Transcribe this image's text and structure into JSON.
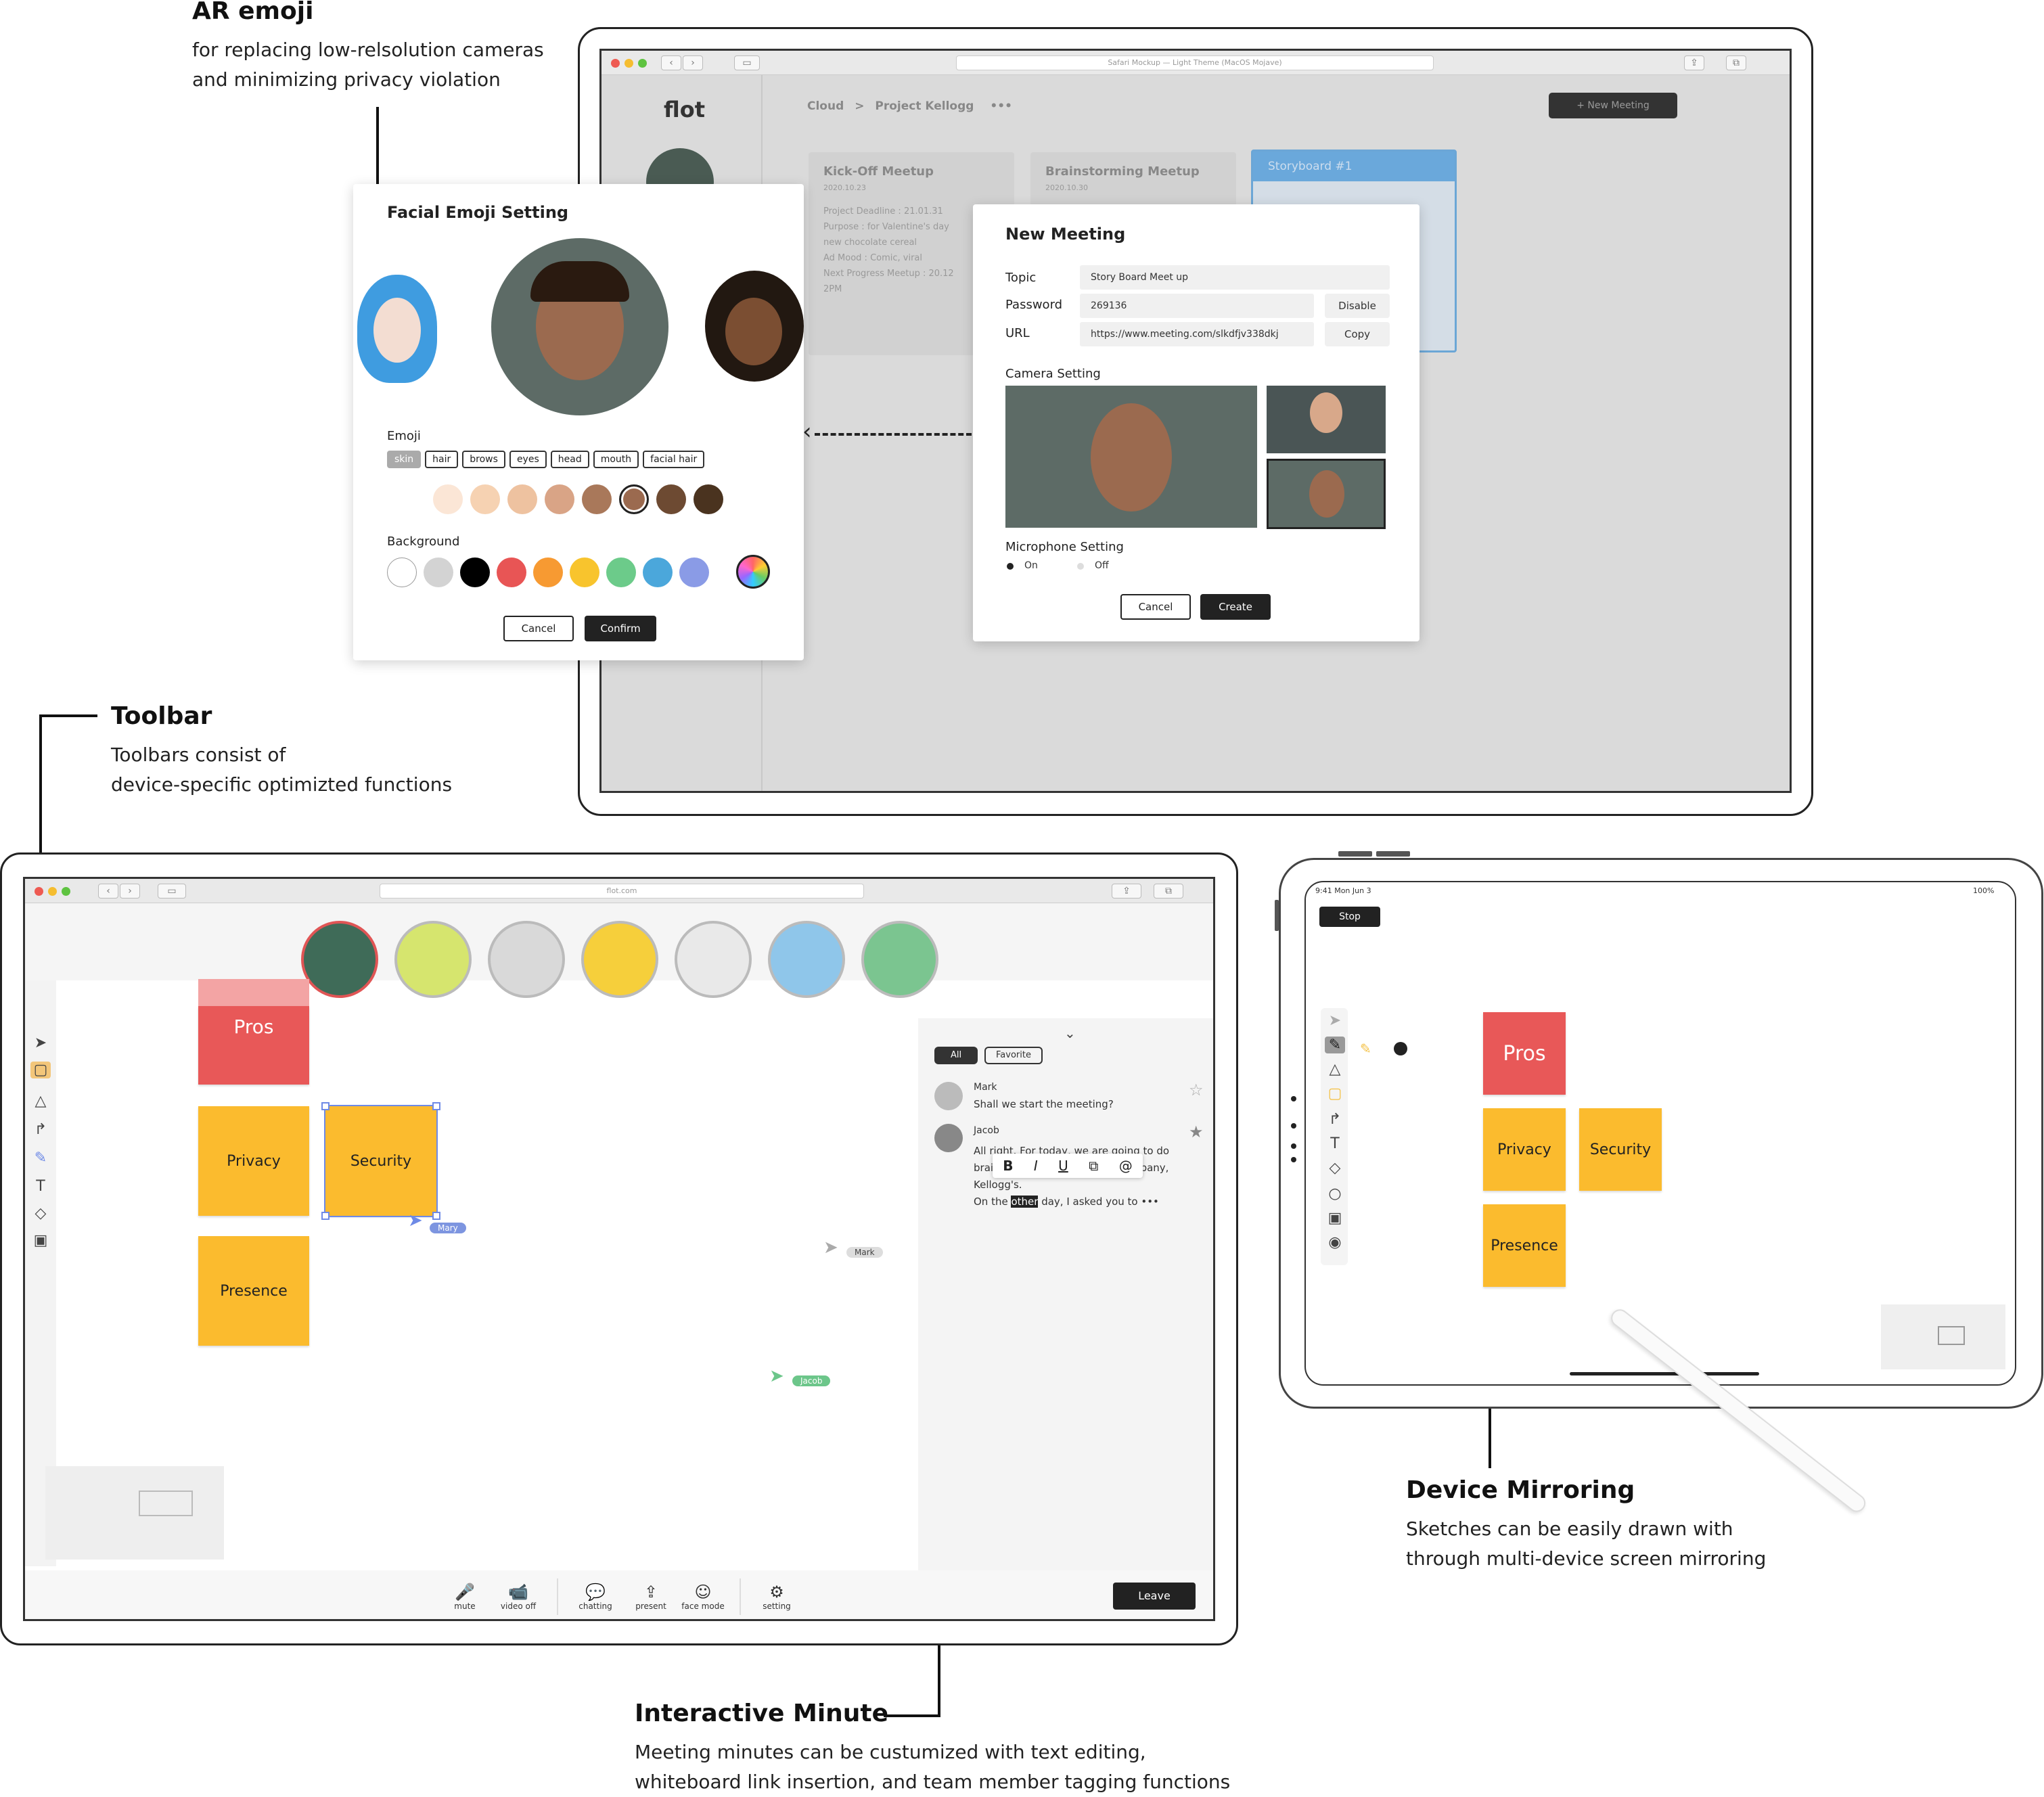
{
  "annotations": {
    "ar_emoji": {
      "title": "AR emoji",
      "sub": "for replacing low-relsolution cameras\nand minimizing privacy violation"
    },
    "toolbar": {
      "title": "Toolbar",
      "sub": "Toolbars consist of\ndevice-specific optimizted functions"
    },
    "device_mirroring": {
      "title": "Device Mirroring",
      "sub": "Sketches can be easily drawn with\nthrough multi-device screen mirroring"
    },
    "interactive_minute": {
      "title": "Interactive Minute",
      "sub": "Meeting minutes can be custumized with text editing,\nwhiteboard link insertion, and team member tagging functions"
    }
  },
  "top_app": {
    "url": "Safari Mockup — Light Theme (MacOS Mojave)",
    "logo": "flot",
    "breadcrumb": [
      "Cloud",
      "Project Kellogg"
    ],
    "breadcrumb_sep": ">",
    "more": "•••",
    "new_meeting_btn": "+ New Meeting",
    "cards": [
      {
        "title": "Kick-Off Meetup",
        "date": "2020.10.23",
        "lines": [
          "Project Deadline : 21.01.31",
          "Purpose : for Valentine's day",
          "new chocolate cereal",
          "Ad Mood : Comic, viral",
          "Next Progress Meetup : 20.12",
          "2PM"
        ]
      },
      {
        "title": "Brainstorming Meetup",
        "date": "2020.10.30",
        "lines": []
      },
      {
        "title": "Storyboard #1",
        "date": "",
        "lines": []
      }
    ]
  },
  "emoji_panel": {
    "title": "Facial Emoji Setting",
    "emoji_label": "Emoji",
    "tags": [
      "skin",
      "hair",
      "brows",
      "eyes",
      "head",
      "mouth",
      "facial hair"
    ],
    "selected_tag": "skin",
    "skin_colors": [
      "#fbe6d6",
      "#f6d2b2",
      "#eec2a0",
      "#d9a486",
      "#a9785a",
      "#9b6a4f",
      "#6d4a32",
      "#4a331f"
    ],
    "selected_skin_index": 5,
    "background_label": "Background",
    "bg_colors": [
      "#ffffff",
      "#d3d3d3",
      "#000000",
      "#e85555",
      "#f79a32",
      "#f8c42d",
      "#6ccb8a",
      "#4ba7db",
      "#8a9be6"
    ],
    "cancel": "Cancel",
    "confirm": "Confirm"
  },
  "new_meeting": {
    "title": "New Meeting",
    "topic_label": "Topic",
    "topic_value": "Story Board Meet up",
    "password_label": "Password",
    "password_value": "269136",
    "disable_btn": "Disable",
    "url_label": "URL",
    "url_value": "https://www.meeting.com/slkdfjv338dkj",
    "copy_btn": "Copy",
    "camera_label": "Camera Setting",
    "mic_label": "Microphone Setting",
    "mic_on": "On",
    "mic_off": "Off",
    "cancel": "Cancel",
    "create": "Create"
  },
  "meeting_app": {
    "url": "flot.com",
    "participants_count": 7,
    "stickies": {
      "pros": "Pros",
      "privacy": "Privacy",
      "security": "Security",
      "presence": "Presence"
    },
    "cursors": {
      "mary": "Mary",
      "mark": "Mark",
      "jacob": "Jacob"
    },
    "minutes": {
      "tabs": [
        "All",
        "Favorite"
      ],
      "messages": [
        {
          "name": "Mark",
          "text": "Shall we start the meeting?"
        },
        {
          "name": "Jacob",
          "text_1": "All right. For today, we are going to do",
          "text_2": "brai",
          "text_2b": "npany,",
          "text_3": "Kellogg's.",
          "text_4a": "On the ",
          "text_4b": "other",
          "text_4c": " day, I asked you to •••"
        }
      ],
      "format_bar": [
        "B",
        "I",
        "U",
        "⧉",
        "@"
      ]
    },
    "controls": [
      {
        "icon": "🎤",
        "label": "mute"
      },
      {
        "icon": "📹",
        "label": "video off"
      },
      {
        "icon": "💬",
        "label": "chatting"
      },
      {
        "icon": "⇪",
        "label": "present"
      },
      {
        "icon": "☺",
        "label": "face mode"
      },
      {
        "icon": "⚙",
        "label": "setting"
      }
    ],
    "leave": "Leave"
  },
  "tablet": {
    "status_left": "9:41 Mon Jun 3",
    "status_right": "100%",
    "stop": "Stop",
    "stickies": {
      "pros": "Pros",
      "privacy": "Privacy",
      "security": "Security",
      "presence": "Presence"
    }
  },
  "colors": {
    "pros": "#e85858",
    "yellow": "#fbbb2e",
    "accent_blue": "#4a90d9",
    "dark": "#222222"
  }
}
